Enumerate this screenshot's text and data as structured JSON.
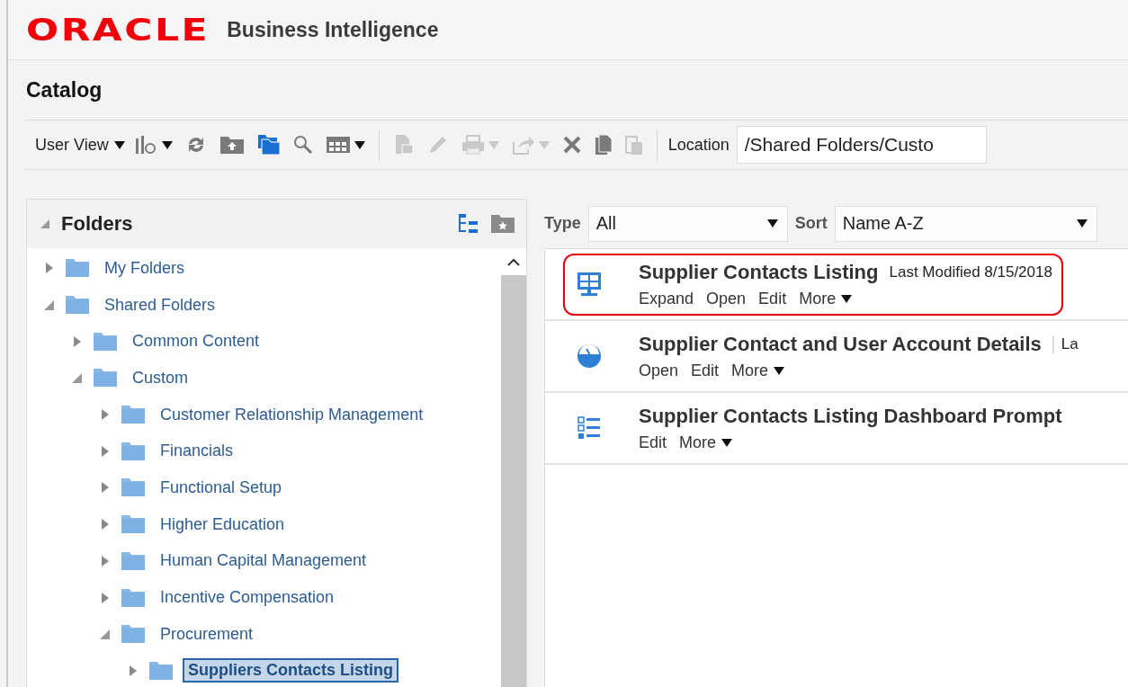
{
  "header": {
    "logo": "ORACLE",
    "product": "Business Intelligence"
  },
  "page_title": "Catalog",
  "toolbar": [
    {
      "kind": "menu",
      "label": "User View",
      "dropdown": true,
      "disabled": false
    },
    {
      "kind": "chart",
      "dropdown": true,
      "disabled": false
    },
    {
      "kind": "refresh",
      "dropdown": false,
      "disabled": false
    },
    {
      "kind": "upload-folder",
      "dropdown": false,
      "disabled": false
    },
    {
      "kind": "open-folder",
      "dropdown": false,
      "disabled": false
    },
    {
      "kind": "search",
      "dropdown": false,
      "disabled": false
    },
    {
      "kind": "grid",
      "dropdown": true,
      "disabled": false
    },
    {
      "kind": "separator"
    },
    {
      "kind": "properties",
      "dropdown": false,
      "disabled": true
    },
    {
      "kind": "edit",
      "dropdown": false,
      "disabled": true
    },
    {
      "kind": "print",
      "dropdown": true,
      "disabled": true
    },
    {
      "kind": "export",
      "dropdown": true,
      "disabled": true
    },
    {
      "kind": "delete",
      "dropdown": false,
      "disabled": false
    },
    {
      "kind": "copy",
      "dropdown": false,
      "disabled": false
    },
    {
      "kind": "paste",
      "dropdown": false,
      "disabled": true
    },
    {
      "kind": "separator"
    }
  ],
  "location": {
    "label": "Location",
    "value": "/Shared Folders/Custo"
  },
  "folders": {
    "title": "Folders",
    "expanded": true,
    "tree": [
      {
        "label": "My Folders",
        "expanded": false,
        "selected": false
      },
      {
        "label": "Shared Folders",
        "expanded": true,
        "selected": false,
        "children": [
          {
            "label": "Common Content",
            "expanded": false,
            "selected": false
          },
          {
            "label": "Custom",
            "expanded": true,
            "selected": false,
            "children": [
              {
                "label": "Customer Relationship Management",
                "expanded": false,
                "selected": false
              },
              {
                "label": "Financials",
                "expanded": false,
                "selected": false
              },
              {
                "label": "Functional Setup",
                "expanded": false,
                "selected": false
              },
              {
                "label": "Higher Education",
                "expanded": false,
                "selected": false
              },
              {
                "label": "Human Capital Management",
                "expanded": false,
                "selected": false
              },
              {
                "label": "Incentive Compensation",
                "expanded": false,
                "selected": false
              },
              {
                "label": "Procurement",
                "expanded": true,
                "selected": false,
                "children": [
                  {
                    "label": "Suppliers Contacts Listing",
                    "expanded": false,
                    "selected": true
                  }
                ]
              }
            ]
          }
        ]
      }
    ]
  },
  "filters": {
    "type_label": "Type",
    "type_value": "All",
    "sort_label": "Sort",
    "sort_value": "Name A-Z"
  },
  "items": [
    {
      "kind": "dashboard",
      "title": "Supplier Contacts Listing",
      "modified": "Last Modified 8/15/2018",
      "highlighted": true,
      "actions": [
        "Expand",
        "Open",
        "Edit",
        "More"
      ]
    },
    {
      "kind": "analysis",
      "title": "Supplier Contact and User Account Details",
      "modified": "La",
      "highlighted": false,
      "actions": [
        "Open",
        "Edit",
        "More"
      ]
    },
    {
      "kind": "prompt",
      "title": "Supplier Contacts Listing Dashboard Prompt",
      "highlighted": false,
      "actions": [
        "Edit",
        "More"
      ]
    }
  ]
}
